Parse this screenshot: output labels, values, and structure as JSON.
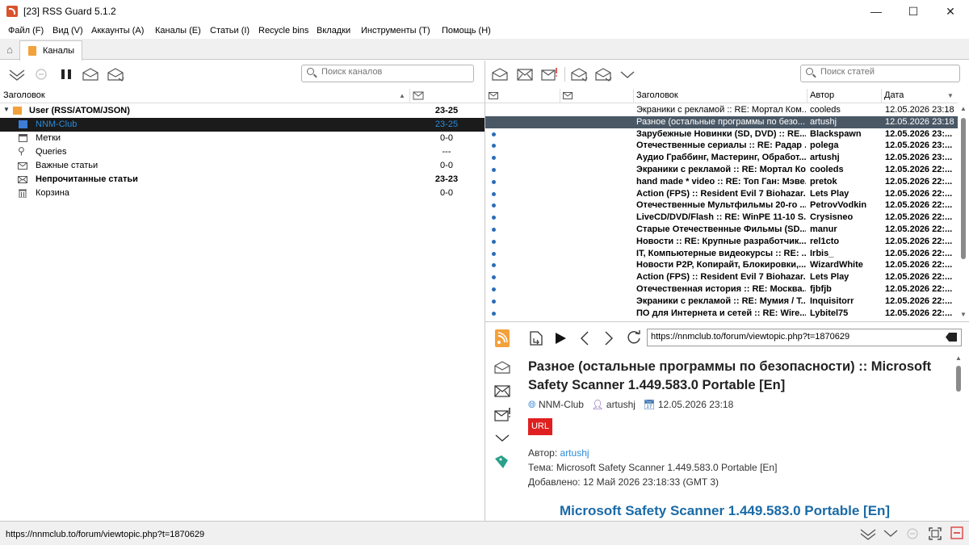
{
  "window": {
    "title": "[23] RSS Guard 5.1.2",
    "minimize": "—",
    "maximize": "☐",
    "close": "✕"
  },
  "menu": [
    "Файл (F)",
    "Вид (V)",
    "Аккаунты (A)",
    "Каналы (E)",
    "Статьи (I)",
    "Recycle bins",
    "Вкладки",
    "Инструменты (T)",
    "Помощь (H)"
  ],
  "tabs": {
    "feeds": "Каналы"
  },
  "feeds_panel": {
    "search_placeholder": "Поиск каналов",
    "header_title": "Заголовок",
    "tree": [
      {
        "label": "User (RSS/ATOM/JSON)",
        "count": "23-25",
        "bold": true
      },
      {
        "label": "NNM-Club",
        "count": "23-25",
        "selected": true
      },
      {
        "label": "Метки",
        "count": "0-0"
      },
      {
        "label": "Queries",
        "count": "---"
      },
      {
        "label": "Важные статьи",
        "count": "0-0"
      },
      {
        "label": "Непрочитанные статьи",
        "count": "23-23",
        "bold": true
      },
      {
        "label": "Корзина",
        "count": "0-0"
      }
    ]
  },
  "articles_panel": {
    "search_placeholder": "Поиск статей",
    "columns": {
      "title": "Заголовок",
      "author": "Автор",
      "date": "Дата"
    },
    "rows": [
      {
        "title": "Экраники с рекламой :: RE: Мортал Ком...",
        "author": "cooleds",
        "date": "12.05.2026 23:18",
        "read": true
      },
      {
        "title": "Разное (остальные программы по безо...",
        "author": "artushj",
        "date": "12.05.2026 23:18",
        "read": true,
        "selected": true
      },
      {
        "title": "Зарубежные Новинки (SD, DVD) :: RE...",
        "author": "Blackspawn",
        "date": "12.05.2026 23:..."
      },
      {
        "title": "Отечественные сериалы :: RE: Радар ...",
        "author": "polega",
        "date": "12.05.2026 23:..."
      },
      {
        "title": "Аудио Граббинг, Мастеринг, Обработ...",
        "author": "artushj",
        "date": "12.05.2026 23:..."
      },
      {
        "title": "Экраники с рекламой :: RE: Мортал Ко...",
        "author": "cooleds",
        "date": "12.05.2026 22:..."
      },
      {
        "title": "hand made * video :: RE: Топ Ган: Мэве...",
        "author": "pretok",
        "date": "12.05.2026 22:..."
      },
      {
        "title": "Action (FPS) :: Resident Evil 7 Biohazar...",
        "author": "Lets Play",
        "date": "12.05.2026 22:..."
      },
      {
        "title": "Отечественные Мультфильмы 20-го ...",
        "author": "PetrovVodkin",
        "date": "12.05.2026 22:..."
      },
      {
        "title": "LiveCD/DVD/Flash :: RE: WinPE 11-10 S...",
        "author": "Crysisneo",
        "date": "12.05.2026 22:..."
      },
      {
        "title": "Старые Отечественные Фильмы (SD...",
        "author": "manur",
        "date": "12.05.2026 22:..."
      },
      {
        "title": "Новости :: RE: Крупные разработчик...",
        "author": "rel1cto",
        "date": "12.05.2026 22:..."
      },
      {
        "title": "IT, Компьютерные видеокурсы :: RE: ...",
        "author": "Irbis_",
        "date": "12.05.2026 22:..."
      },
      {
        "title": "Новости P2P, Копирайт, Блокировки,...",
        "author": "WizardWhite",
        "date": "12.05.2026 22:..."
      },
      {
        "title": "Action (FPS) :: Resident Evil 7 Biohazar...",
        "author": "Lets Play",
        "date": "12.05.2026 22:..."
      },
      {
        "title": "Отечественная история :: RE: Москва...",
        "author": "fjbfjb",
        "date": "12.05.2026 22:..."
      },
      {
        "title": "Экраники с рекламой :: RE: Мумия / Т...",
        "author": "Inquisitorr",
        "date": "12.05.2026 22:..."
      },
      {
        "title": "ПО для Интернета и сетей :: RE: Wire...",
        "author": "Lybitel75",
        "date": "12.05.2026 22:..."
      }
    ]
  },
  "preview": {
    "url": "https://nnmclub.to/forum/viewtopic.php?t=1870629",
    "title": "Разное (остальные программы по безопасности) :: Microsoft Safety Scanner 1.449.583.0 Portable [En]",
    "feed": "NNM-Club",
    "author": "artushj",
    "date": "12.05.2026 23:18",
    "badge": "URL",
    "author_label": "Автор:",
    "author_link": "artushj",
    "topic_line": "Тема: Microsoft Safety Scanner 1.449.583.0 Portable [En]",
    "added_line": "Добавлено: 12 Май 2026 23:18:33 (GMT 3)",
    "heading": "Microsoft Safety Scanner 1.449.583.0 Portable [En]"
  },
  "status": {
    "text": "https://nnmclub.to/forum/viewtopic.php?t=1870629"
  },
  "colors": {
    "accent": "#2b8bd9",
    "selected_row": "#4a5866",
    "unread_dot": "#2b6cb8",
    "badge": "#e02020",
    "link": "#1a6aa6"
  }
}
